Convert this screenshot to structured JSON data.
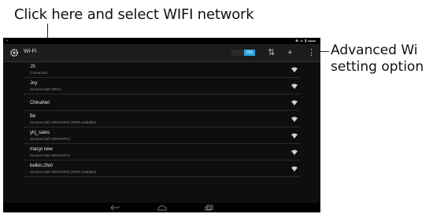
{
  "annotations": {
    "top": "Click here and select WIFI network",
    "right_line1": "Advanced Wi",
    "right_line2": "setting option"
  },
  "header": {
    "title": "Wi-Fi",
    "toggle_label": "ON"
  },
  "colors": {
    "accent": "#2aa3dc",
    "background": "#0e0e0e",
    "actionbar": "#1c1c1c"
  },
  "icons": {
    "settings": "settings-gear-icon",
    "wps": "wps-icon",
    "add": "add-network-icon",
    "overflow": "overflow-menu-icon",
    "wifi": "wifi-signal-icon",
    "back": "back-icon",
    "home": "home-icon",
    "recents": "recents-icon"
  },
  "networks": [
    {
      "ssid": "JS",
      "status": "Connected"
    },
    {
      "ssid": "Joy",
      "status": "Secured with WPA2"
    },
    {
      "ssid": "ChinaNet",
      "status": ""
    },
    {
      "ssid": "Be",
      "status": "Secured with WPA/WPA2 (WPS available)"
    },
    {
      "ssid": "yhj_sales",
      "status": "Secured with WPA/WPA2"
    },
    {
      "ssid": "macyt new",
      "status": "Secured with WPA/WPA2"
    },
    {
      "ssid": "belkin.2fe0",
      "status": "Secured with WPA/WPA2 (WPS available)"
    }
  ]
}
